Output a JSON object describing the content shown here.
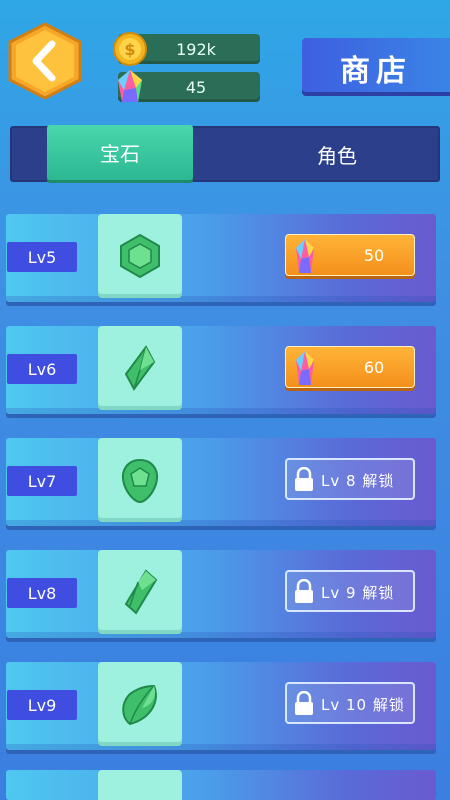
{
  "header": {
    "title": "商店",
    "coins": "192k",
    "gems": "45"
  },
  "tabs": [
    {
      "label": "宝石",
      "active": true
    },
    {
      "label": "角色",
      "active": false
    }
  ],
  "items": [
    {
      "level": "Lv5",
      "state": "buy",
      "price": "50"
    },
    {
      "level": "Lv6",
      "state": "buy",
      "price": "60"
    },
    {
      "level": "Lv7",
      "state": "locked",
      "lock_text": "Lv 8 解锁"
    },
    {
      "level": "Lv8",
      "state": "locked",
      "lock_text": "Lv 9 解锁"
    },
    {
      "level": "Lv9",
      "state": "locked",
      "lock_text": "Lv 10 解锁"
    }
  ],
  "colors": {
    "accent_orange": "#f3901c",
    "tab_active": "#2cb891",
    "level_tag": "#3f4ee0",
    "gem_green": "#3fbf6a"
  }
}
